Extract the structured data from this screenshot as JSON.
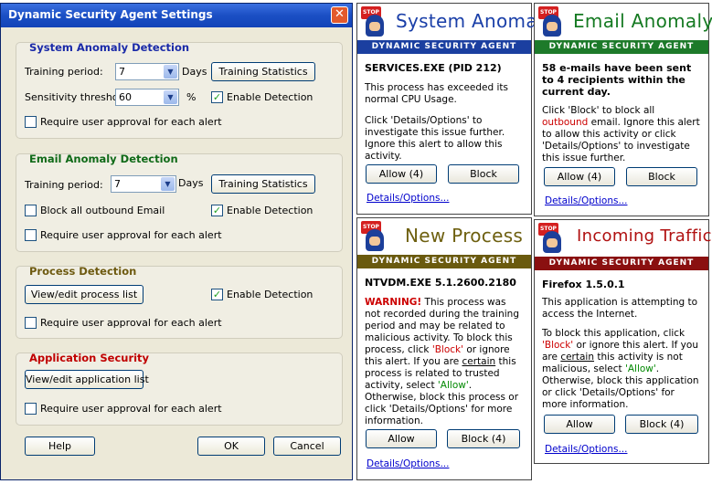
{
  "window": {
    "title": "Dynamic Security Agent Settings",
    "close_glyph": "✕"
  },
  "system_anomaly": {
    "heading": "System Anomaly Detection",
    "training_label": "Training period:",
    "training_value": "7",
    "days_label": "Days",
    "stats_button": "Training Statistics",
    "sensitivity_label": "Sensitivity threshold:",
    "sensitivity_value": "60",
    "percent_label": "%",
    "enable_label": "Enable Detection",
    "enable_checked": true,
    "approval_label": "Require user approval for each alert",
    "approval_checked": false
  },
  "email_anomaly": {
    "heading": "Email Anomaly Detection",
    "training_label": "Training period:",
    "training_value": "7",
    "days_label": "Days",
    "stats_button": "Training Statistics",
    "block_label": "Block all outbound Email",
    "block_checked": false,
    "enable_label": "Enable Detection",
    "enable_checked": true,
    "approval_label": "Require user approval for each alert",
    "approval_checked": false
  },
  "process_detection": {
    "heading": "Process Detection",
    "list_button": "View/edit process list",
    "enable_label": "Enable Detection",
    "enable_checked": true,
    "approval_label": "Require user approval for each alert",
    "approval_checked": false
  },
  "app_security": {
    "heading": "Application Security",
    "list_button": "View/edit application list",
    "approval_label": "Require user approval for each alert",
    "approval_checked": false
  },
  "footer": {
    "help": "Help",
    "ok": "OK",
    "cancel": "Cancel"
  },
  "alerts": {
    "band_text": "DYNAMIC SECURITY AGENT",
    "stop_text": "STOP",
    "details_link": "Details/Options...",
    "system": {
      "title": "System Anomaly",
      "title_color": "#1a3fa8",
      "band_color": "#1b3fa0",
      "headline": "SERVICES.EXE (PID 212)",
      "p1": "This process has exceeded its normal CPU Usage.",
      "p2": "Click 'Details/Options' to investigate this issue further.  Ignore this alert to allow this activity.",
      "allow": "Allow (4)",
      "block": "Block"
    },
    "email": {
      "title": "Email Anomaly",
      "title_color": "#157a22",
      "band_color": "#1d7a2a",
      "headline": "58 e-mails have been sent to 4 recipients within the current day.",
      "p_pre": "Click 'Block' to block all ",
      "p_red": "outbound",
      "p_post": " email. Ignore this alert to allow this activity or click 'Details/Options' to investigate this issue further.",
      "allow": "Allow (4)",
      "block": "Block"
    },
    "process": {
      "title": "New Process",
      "title_color": "#6e6010",
      "band_color": "#6a5a0e",
      "headline": "NTVDM.EXE 5.1.2600.2180",
      "warning": "WARNING!",
      "p1": " This process was not recorded during the training period and may be related to malicious activity. To block this process, click ",
      "block_q": "'Block'",
      "p2": " or ignore this alert. If you are ",
      "certain": "certain",
      "p3": " this process is related to trusted activity, select ",
      "allow_q": "'Allow'",
      "p4": ". Otherwise, block this process or click 'Details/Options' for more information.",
      "allow": "Allow",
      "block": "Block (4)"
    },
    "traffic": {
      "title": "Incoming Traffic",
      "title_color": "#b01010",
      "band_color": "#8a1010",
      "headline": "Firefox 1.5.0.1",
      "p1": "This application is attempting to access the Internet.",
      "p2a": "To block this application, click ",
      "block_q": "'Block'",
      "p2b": " or ignore this alert. If you are ",
      "certain": "certain",
      "p2c": " this activity is not malicious, select ",
      "allow_q": "'Allow'",
      "p2d": ". Otherwise, block this application or click 'Details/Options' for more information.",
      "allow": "Allow",
      "block": "Block (4)"
    }
  }
}
